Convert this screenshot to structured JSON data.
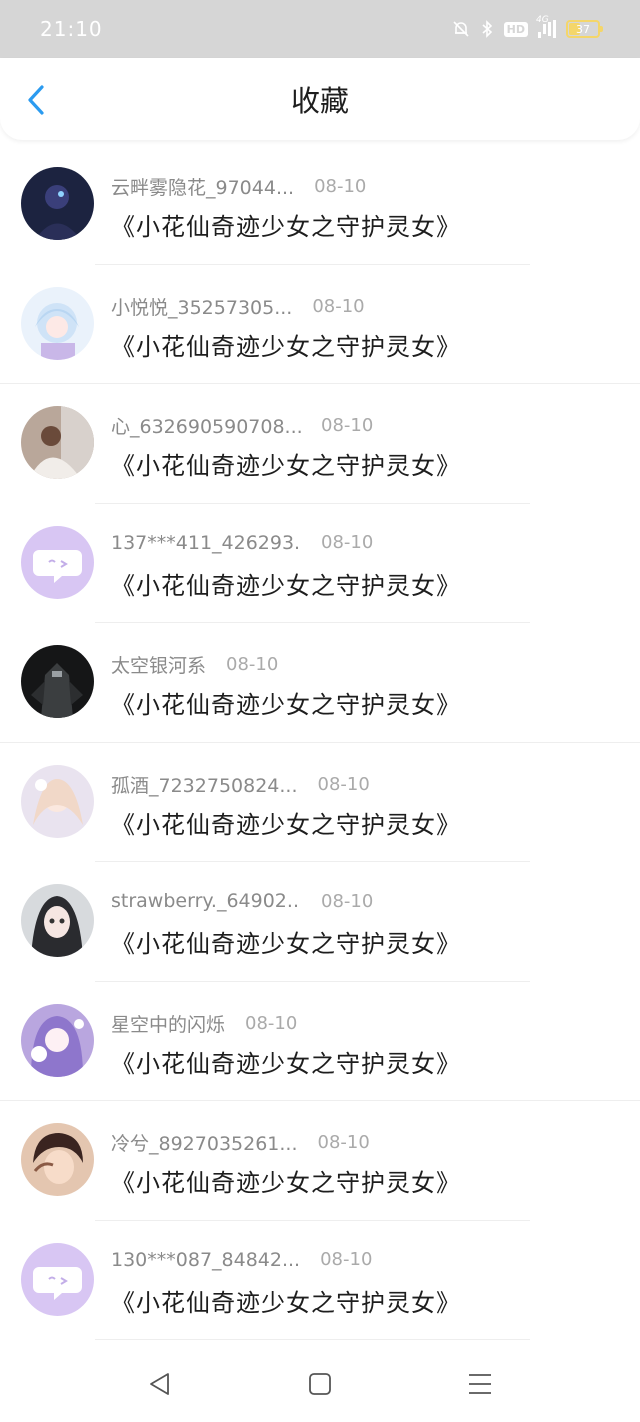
{
  "status_bar": {
    "time": "21:10",
    "hd": "HD",
    "network": "4G",
    "battery": "37",
    "battery_level": 0.37,
    "icons": [
      "mute-bell-icon",
      "bluetooth-icon",
      "hd-icon",
      "signal-icon",
      "battery-icon"
    ]
  },
  "header": {
    "title": "收藏",
    "back_icon": "chevron-left-icon",
    "accent": "#2b9bf0"
  },
  "items": [
    {
      "user": "云畔雾隐花_97044...",
      "date": "08-10",
      "title": "《小花仙奇迹少女之守护灵女》",
      "avatar": "avatar-dark-knight"
    },
    {
      "user": "小悦悦_35257305...",
      "date": "08-10",
      "title": "《小花仙奇迹少女之守护灵女》",
      "avatar": "avatar-anime-girl-blue"
    },
    {
      "user": "心_632690590708...",
      "date": "08-10",
      "title": "《小花仙奇迹少女之守护灵女》",
      "avatar": "avatar-photo-person"
    },
    {
      "user": "137***411_426293...",
      "date": "08-10",
      "title": "《小花仙奇迹少女之守护灵女》",
      "avatar": "avatar-default-chat"
    },
    {
      "user": "太空银河系",
      "date": "08-10",
      "title": "《小花仙奇迹少女之守护灵女》",
      "avatar": "avatar-mecha"
    },
    {
      "user": "孤酒_7232750824...",
      "date": "08-10",
      "title": "《小花仙奇迹少女之守护灵女》",
      "avatar": "avatar-fairy"
    },
    {
      "user": "strawberry._64902...",
      "date": "08-10",
      "title": "《小花仙奇迹少女之守护灵女》",
      "avatar": "avatar-doll-girl"
    },
    {
      "user": "星空中的闪烁",
      "date": "08-10",
      "title": "《小花仙奇迹少女之守护灵女》",
      "avatar": "avatar-purple-anime"
    },
    {
      "user": "冷兮_8927035261...",
      "date": "08-10",
      "title": "《小花仙奇迹少女之守护灵女》",
      "avatar": "avatar-anime-boy"
    },
    {
      "user": "130***087_84842...",
      "date": "08-10",
      "title": "《小花仙奇迹少女之守护灵女》",
      "avatar": "avatar-default-chat"
    }
  ],
  "nav": {
    "icons": [
      "back-triangle-icon",
      "home-square-icon",
      "menu-lines-icon"
    ]
  }
}
